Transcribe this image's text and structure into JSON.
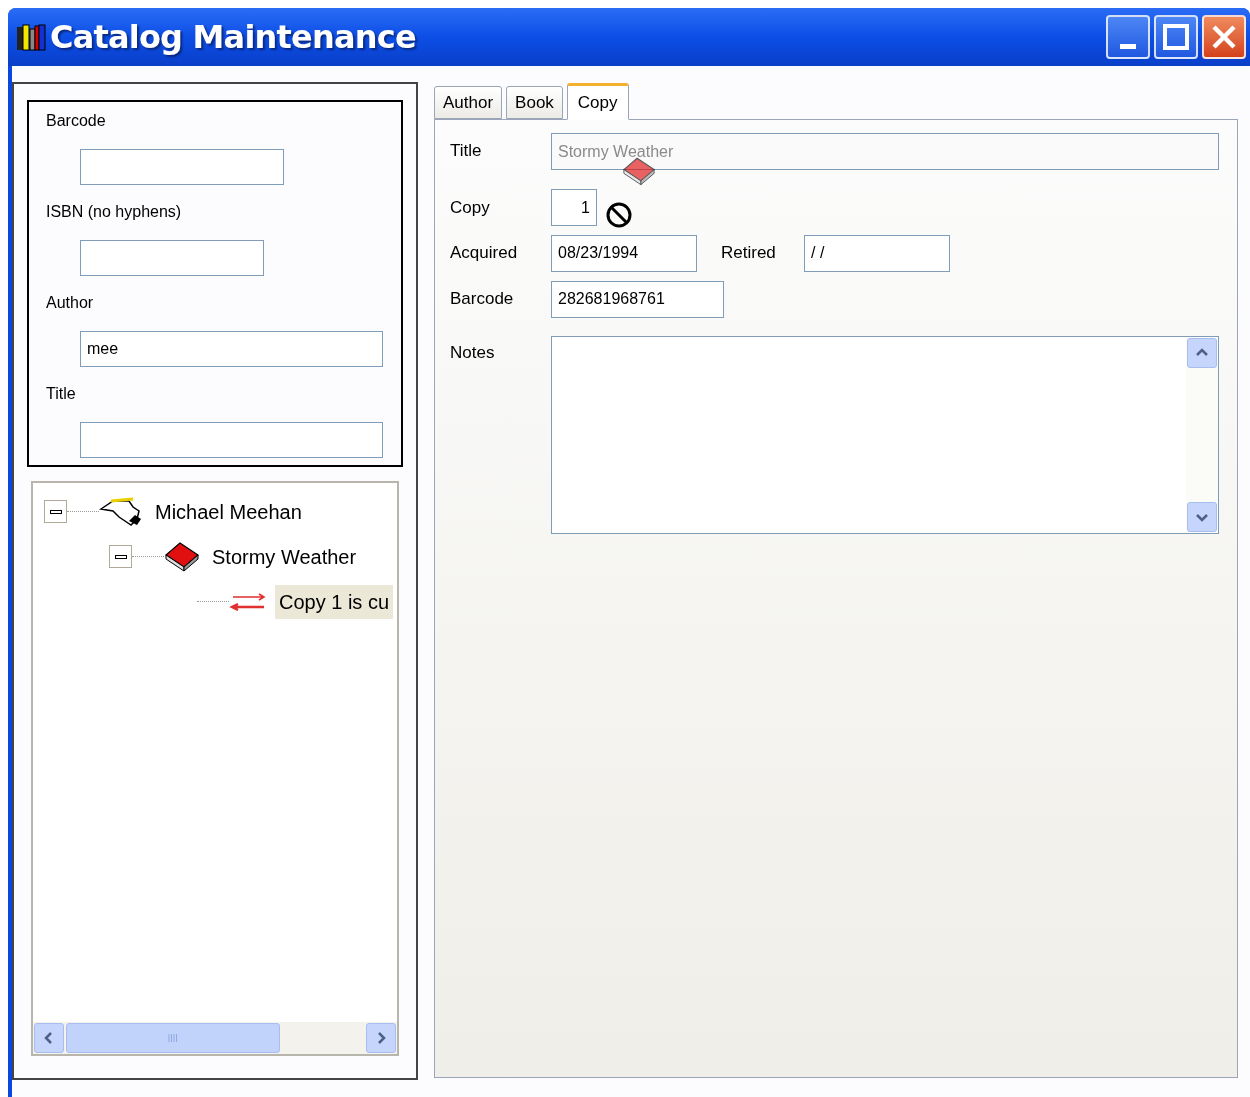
{
  "window": {
    "title": "Catalog Maintenance"
  },
  "search": {
    "fields": [
      {
        "label": "Barcode"
      },
      {
        "label": "ISBN (no hyphens)"
      },
      {
        "label": "Author",
        "value": "mee"
      },
      {
        "label": "Title"
      }
    ]
  },
  "tree": [
    {
      "label": "Michael Meehan",
      "kind": "author",
      "expanded": true,
      "selected": false,
      "children": [
        {
          "label": "Stormy Weather",
          "kind": "book",
          "expanded": true,
          "selected": false,
          "children": [
            {
              "label": "Copy 1 is cu",
              "kind": "copy",
              "selected": true
            }
          ]
        }
      ]
    }
  ],
  "tabs": [
    {
      "label": "Author",
      "selected": false
    },
    {
      "label": "Book",
      "selected": false
    },
    {
      "label": "Copy",
      "selected": true
    }
  ],
  "form": {
    "title": {
      "label": "Title",
      "value": "Stormy Weather",
      "disabled": true
    },
    "copy": {
      "label": "Copy",
      "value": "1"
    },
    "acquired": {
      "label": "Acquired",
      "value": "08/23/1994"
    },
    "retired": {
      "label": "Retired",
      "value": "/ /"
    },
    "barcode": {
      "label": "Barcode",
      "value": "282681968761"
    },
    "notes": {
      "label": "Notes"
    }
  }
}
